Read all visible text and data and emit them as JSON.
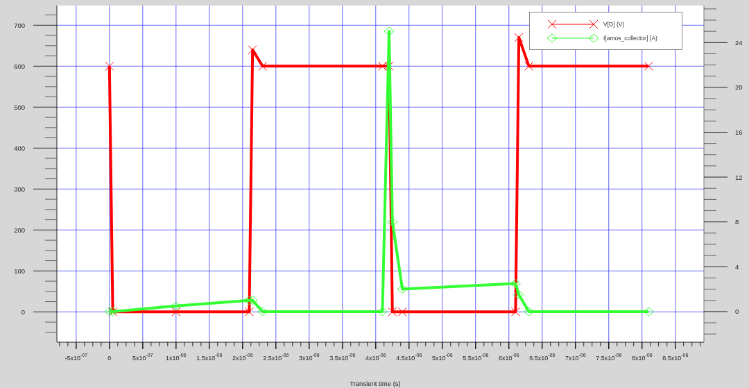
{
  "chart_data": {
    "type": "line",
    "xlabel": "Transient time (s)",
    "x": [
      0,
      5e-08,
      1e-06,
      2.1e-06,
      2.15e-06,
      2.3e-06,
      4.1e-06,
      4.2e-06,
      4.25e-06,
      4.4e-06,
      6.1e-06,
      6.15e-06,
      6.3e-06,
      8.1e-06
    ],
    "series": [
      {
        "name": "V[D] (V)",
        "color": "#ff0000",
        "marker": "cross",
        "values": [
          600,
          0,
          0,
          0,
          640,
          600,
          600,
          600,
          0,
          0,
          0,
          670,
          600,
          600
        ]
      },
      {
        "name": "I[amos_collector] (A)",
        "color": "#33ff33",
        "marker": "diamond",
        "axis": "y2",
        "values": [
          0,
          0,
          0.5,
          1,
          1,
          0,
          0,
          25,
          8,
          2,
          2.5,
          1.5,
          0,
          0
        ]
      }
    ],
    "grid": true,
    "xlim": [
      -7.9e-07,
      8.93e-06
    ],
    "ylim": [
      -74,
      748
    ],
    "y2lim": [
      -2.73,
      27.3
    ],
    "xticks": [
      {
        "value": -5e-07,
        "label": "-5x10$^{-07}$"
      },
      {
        "value": 0,
        "label": "0"
      },
      {
        "value": 5e-07,
        "label": "5x10$^{-07}$"
      },
      {
        "value": 1e-06,
        "label": "1x10$^{-06}$"
      },
      {
        "value": 1.5e-06,
        "label": "1.5x10$^{-06}$"
      },
      {
        "value": 2e-06,
        "label": "2x10$^{-06}$"
      },
      {
        "value": 2.5e-06,
        "label": "2.5x10$^{-06}$"
      },
      {
        "value": 3e-06,
        "label": "3x10$^{-06}$"
      },
      {
        "value": 3.5e-06,
        "label": "3.5x10$^{-06}$"
      },
      {
        "value": 4e-06,
        "label": "4x10$^{-06}$"
      },
      {
        "value": 4.5e-06,
        "label": "4.5x10$^{-06}$"
      },
      {
        "value": 5e-06,
        "label": "5x10$^{-06}$"
      },
      {
        "value": 5.5e-06,
        "label": "5.5x10$^{-06}$"
      },
      {
        "value": 6e-06,
        "label": "6x10$^{-06}$"
      },
      {
        "value": 6.5e-06,
        "label": "6.5x10$^{-06}$"
      },
      {
        "value": 7e-06,
        "label": "7x10$^{-06}$"
      },
      {
        "value": 7.5e-06,
        "label": "7.5x10$^{-06}$"
      },
      {
        "value": 8e-06,
        "label": "8x10$^{-06}$"
      },
      {
        "value": 8.5e-06,
        "label": "8.5x10$^{-06}$"
      }
    ],
    "yticks": [
      0,
      100,
      200,
      300,
      400,
      500,
      600,
      700
    ],
    "y2ticks": [
      0,
      4,
      8,
      12,
      16,
      20,
      24
    ]
  }
}
